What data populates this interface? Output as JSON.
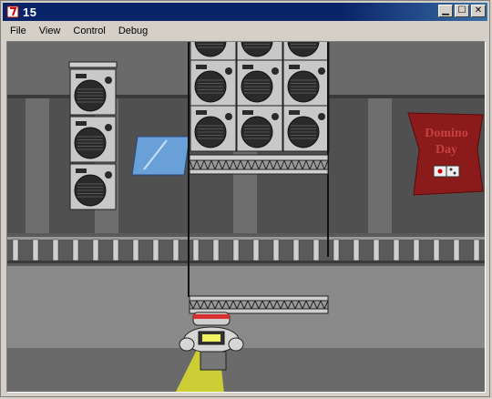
{
  "window": {
    "title": "15",
    "icon": "app-logo-icon",
    "controls": [
      "minimize-icon",
      "maximize-icon",
      "close-icon"
    ]
  },
  "menu": {
    "items": [
      {
        "label": "File"
      },
      {
        "label": "View"
      },
      {
        "label": "Control"
      },
      {
        "label": "Debug"
      }
    ]
  },
  "game": {
    "banner": {
      "line1": "Domino",
      "line2": "Day"
    },
    "colors": {
      "wall": "#505050",
      "floor": "#8a8a8a",
      "banner": "#8b1a1a",
      "spotlight": "#d8d830",
      "glass": "#6aa0d8"
    }
  }
}
